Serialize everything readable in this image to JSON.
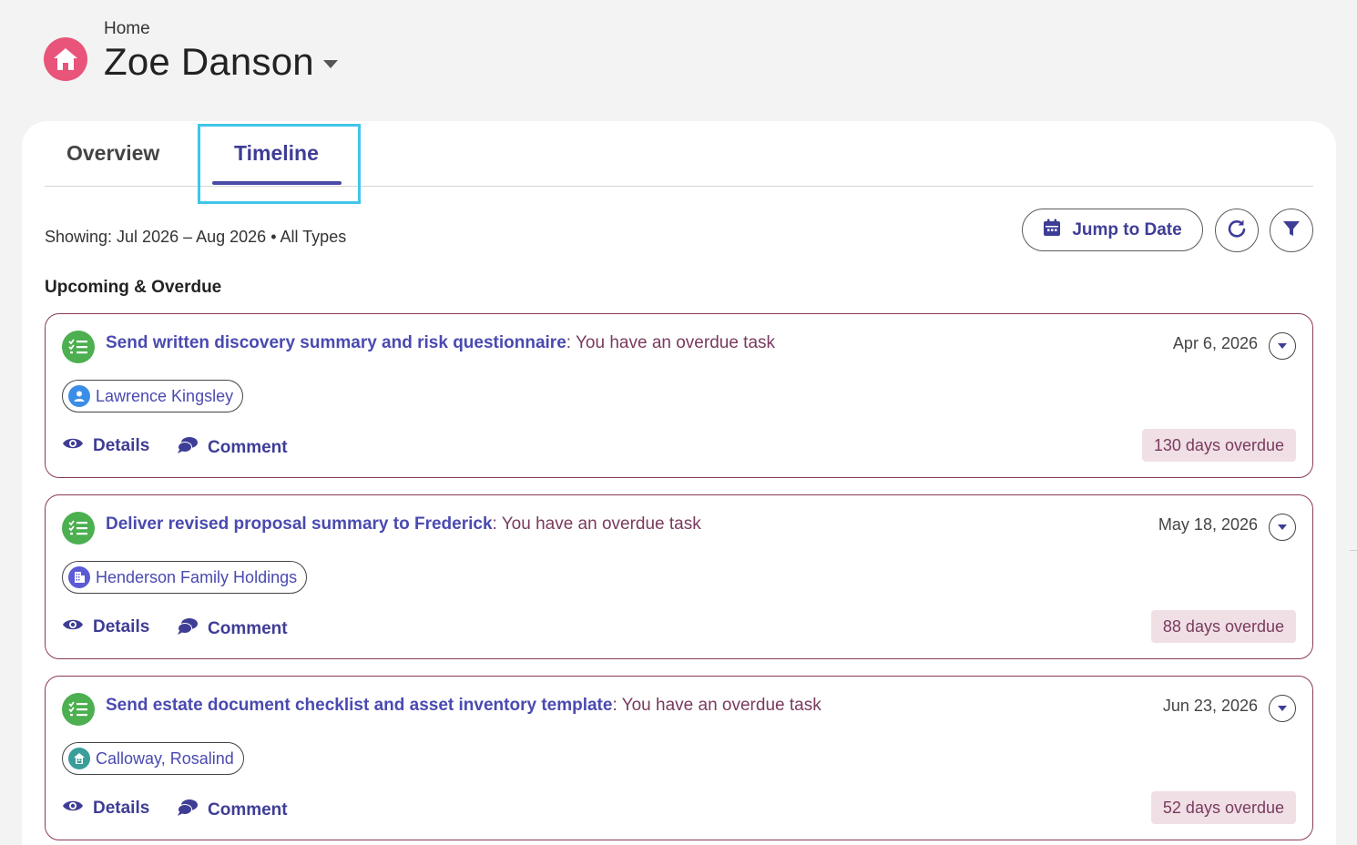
{
  "header": {
    "breadcrumb": "Home",
    "title": "Zoe Danson",
    "icon": "home-icon",
    "accent": "#e8547a"
  },
  "tabs": [
    {
      "label": "Overview",
      "active": false
    },
    {
      "label": "Timeline",
      "active": true
    }
  ],
  "toolbar": {
    "showing": "Showing: Jul 2026 – Aug 2026 • All Types",
    "jump_label": "Jump to Date",
    "refresh_icon": "refresh-icon",
    "filter_icon": "filter-icon"
  },
  "section": {
    "title": "Upcoming & Overdue"
  },
  "items": [
    {
      "task": "Send written discovery summary and risk questionnaire",
      "separator": ":",
      "status": " You have an overdue task",
      "date": "Apr 6, 2026",
      "chip": "Lawrence Kingsley",
      "chip_icon": "person-icon",
      "details_label": "Details",
      "comment_label": "Comment",
      "overdue": "130 days overdue"
    },
    {
      "task": "Deliver revised proposal summary to Frederick",
      "separator": ":",
      "status": " You have an overdue task",
      "date": "May 18, 2026",
      "chip": "Henderson Family Holdings",
      "chip_icon": "building-icon",
      "details_label": "Details",
      "comment_label": "Comment",
      "overdue": "88 days overdue"
    },
    {
      "task": "Send estate document checklist and asset inventory template",
      "separator": ":",
      "status": " You have an overdue task",
      "date": "Jun 23, 2026",
      "chip": "Calloway, Rosalind",
      "chip_icon": "household-icon",
      "details_label": "Details",
      "comment_label": "Comment",
      "overdue": "52 days overdue"
    }
  ],
  "colors": {
    "primary": "#3e3d96",
    "task_icon": "#4caf50",
    "overdue_bg": "#f0e0e6",
    "card_border": "#8a3a5a",
    "highlight": "#3fc6ea"
  }
}
